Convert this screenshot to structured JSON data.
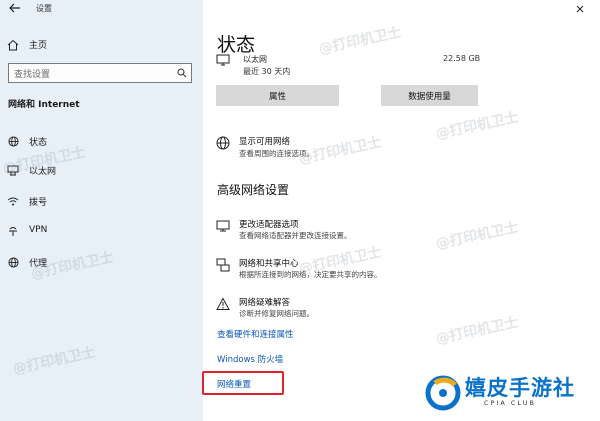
{
  "window": {
    "title": "设置"
  },
  "sidebar": {
    "home_label": "主页",
    "search_placeholder": "查找设置",
    "section_title": "网络和 Internet",
    "items": [
      {
        "label": "状态",
        "icon": "globe-icon"
      },
      {
        "label": "以太网",
        "icon": "ethernet-icon"
      },
      {
        "label": "拨号",
        "icon": "dialup-icon"
      },
      {
        "label": "VPN",
        "icon": "vpn-icon"
      },
      {
        "label": "代理",
        "icon": "proxy-globe-icon"
      }
    ]
  },
  "main": {
    "page_title": "状态",
    "ethernet": {
      "name": "以太网",
      "duration": "最近 30 天内",
      "usage": "22.58 GB"
    },
    "buttons": {
      "properties": "属性",
      "data_usage": "数据使用量"
    },
    "show_networks": {
      "title": "显示可用网络",
      "desc": "查看周围的连接选项。"
    },
    "advanced_heading": "高级网络设置",
    "advanced_items": [
      {
        "title": "更改适配器选项",
        "desc": "查看网络适配器并更改连接设置。"
      },
      {
        "title": "网络和共享中心",
        "desc": "根据所连接到的网络，决定要共享的内容。"
      },
      {
        "title": "网络疑难解答",
        "desc": "诊断并修复网络问题。"
      }
    ],
    "links": {
      "hardware": "查看硬件和连接属性",
      "firewall": "Windows 防火墙",
      "reset": "网络重置"
    }
  },
  "watermark": {
    "text": "@打印机卫士"
  },
  "logo": {
    "title": "嬉皮手游社",
    "subtitle": "CPIA CLUB"
  },
  "colors": {
    "sidebar_bg": "#e8f0f7",
    "link": "#0a56b8",
    "highlight": "#e0222b",
    "button_bg": "#d8d8d8"
  }
}
